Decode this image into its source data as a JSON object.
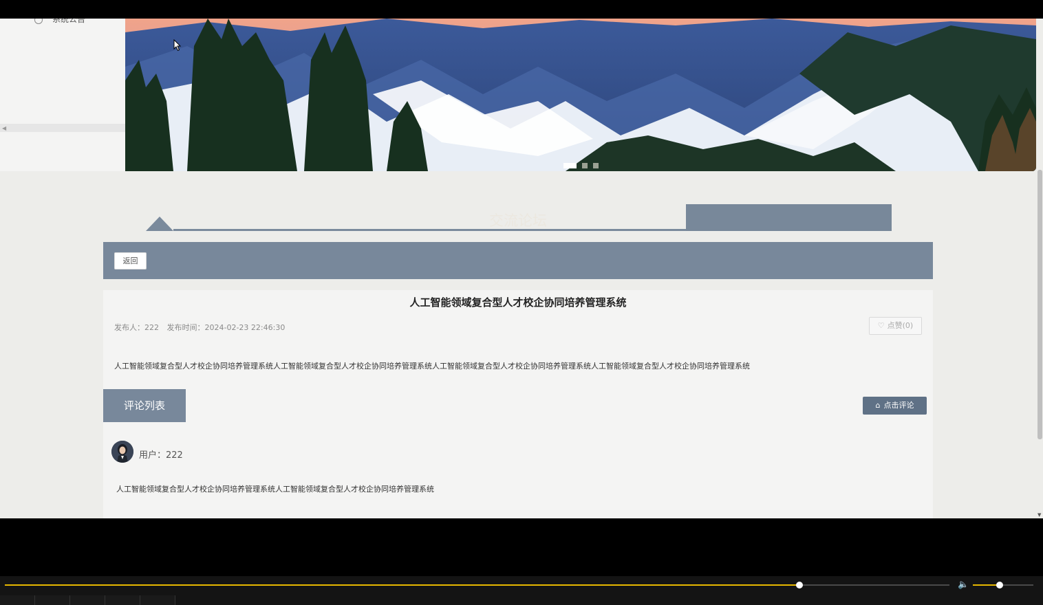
{
  "sidebar": {
    "menu_item": "系统公告"
  },
  "banner": {
    "slides_total": 3,
    "active_slide": 1
  },
  "forum": {
    "section_title": "交流论坛",
    "back_label": "返回",
    "post": {
      "title": "人工智能领域复合型人才校企协同培养管理系统",
      "author_label": "发布人：222",
      "time_label": "发布时间：2024-02-23 22:46:30",
      "like_label": "点赞(0)",
      "content": "人工智能领域复合型人才校企协同培养管理系统人工智能领域复合型人才校企协同培养管理系统人工智能领域复合型人才校企协同培养管理系统人工智能领域复合型人才校企协同培养管理系统"
    },
    "comments_tab": "评论列表",
    "comment_button": "点击评论",
    "comments": [
      {
        "user": "用户：222",
        "text": "人工智能领域复合型人才校企协同培养管理系统人工智能领域复合型人才校企协同培养管理系统"
      }
    ]
  },
  "player": {
    "progress": 0.84,
    "volume": 0.45
  },
  "colors": {
    "accent": "#78889b",
    "page_bg": "#ededea",
    "card_bg": "#f4f4f3",
    "progress": "#e8b800"
  }
}
